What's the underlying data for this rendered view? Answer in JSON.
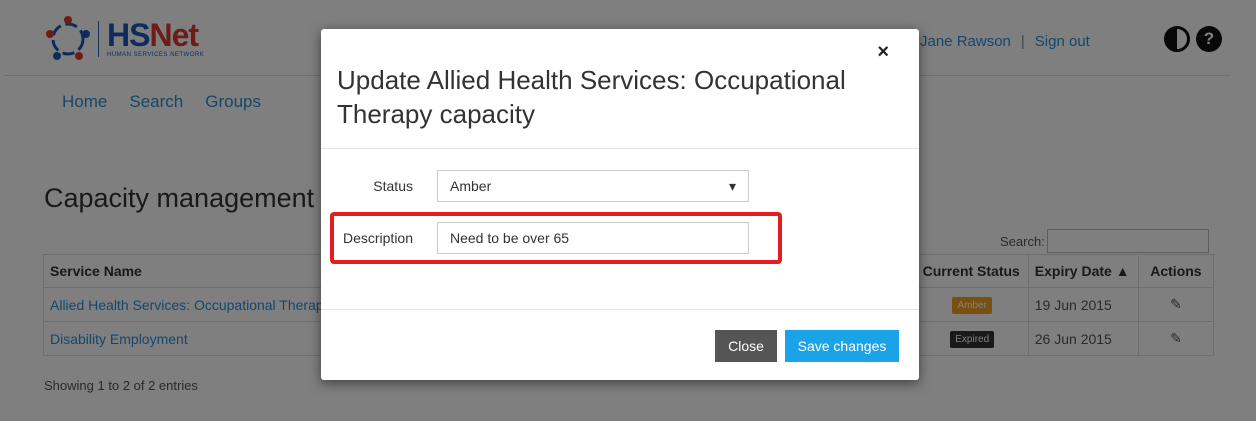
{
  "header": {
    "logo_title_a": "HS",
    "logo_title_b": "Net",
    "logo_subtitle": "HUMAN SERVICES NETWORK",
    "user_name": "Jane Rawson",
    "separator": "|",
    "sign_out": "Sign out",
    "help_icon_glyph": "?"
  },
  "nav": {
    "items": [
      "Home",
      "Search",
      "Groups"
    ]
  },
  "page": {
    "title": "Capacity management",
    "search_label": "Search:"
  },
  "table": {
    "columns": [
      "Service Name",
      "Current Status",
      "Expiry Date",
      "Actions"
    ],
    "rows": [
      {
        "name": "Allied Health Services: Occupational Therapy",
        "status": "Amber",
        "expiry": "19 Jun 2015"
      },
      {
        "name": "Disability Employment",
        "status": "Expired",
        "expiry": "26 Jun 2015"
      }
    ],
    "info": "Showing 1 to 2 of 2 entries"
  },
  "modal": {
    "title": "Update Allied Health Services: Occupational Therapy capacity",
    "close_symbol": "×",
    "status_label": "Status",
    "status_value": "Amber",
    "description_label": "Description",
    "description_value": "Need to be over 65",
    "close_button": "Close",
    "save_button": "Save changes"
  },
  "colors": {
    "link": "#2a8fd6",
    "amber": "#f0a020",
    "expired": "#333333",
    "primary_button": "#1ba3e8",
    "highlight": "#e31d1d"
  },
  "icons": {
    "contrast": "contrast-icon",
    "help": "help-icon",
    "dropdown": "caret-down-icon",
    "edit": "edit-icon",
    "sort": "sort-asc-icon"
  }
}
